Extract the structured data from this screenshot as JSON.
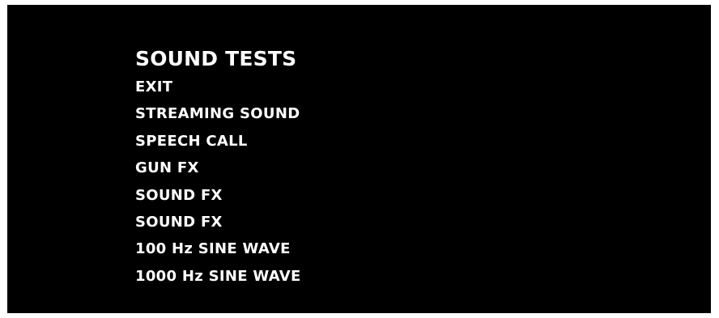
{
  "screen": {
    "title": "SOUND TESTS",
    "items": [
      {
        "label": "EXIT"
      },
      {
        "label": "STREAMING SOUND"
      },
      {
        "label": "SPEECH CALL"
      },
      {
        "label": "GUN FX"
      },
      {
        "label": "SOUND FX"
      },
      {
        "label": "SOUND FX"
      },
      {
        "label": "100 Hz SINE WAVE"
      },
      {
        "label": "1000 Hz SINE WAVE"
      }
    ]
  },
  "colors": {
    "background": "#000000",
    "text": "#ffffff",
    "border": "#ffffff"
  }
}
